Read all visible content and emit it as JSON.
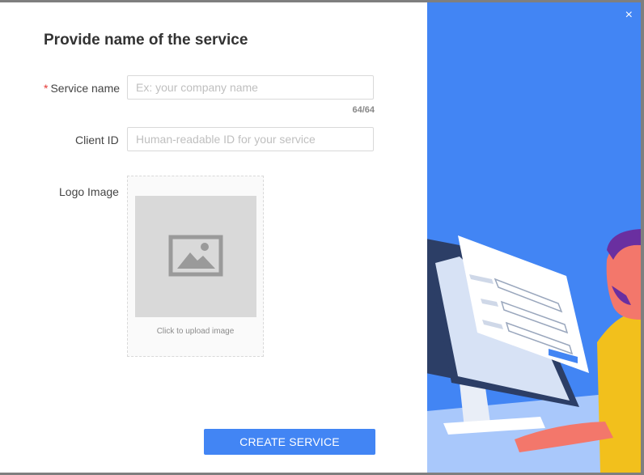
{
  "dialog": {
    "title": "Provide name of the service",
    "close_label": "×"
  },
  "form": {
    "service_name": {
      "required_mark": "*",
      "label": "Service name",
      "placeholder": "Ex: your company name",
      "value": "",
      "counter": "64/64"
    },
    "client_id": {
      "label": "Client ID",
      "placeholder": "Human-readable ID for your service",
      "value": ""
    },
    "logo": {
      "label": "Logo Image",
      "upload_text": "Click to upload image",
      "icon": "image-placeholder-icon"
    }
  },
  "actions": {
    "create_label": "CREATE SERVICE"
  },
  "colors": {
    "accent": "#4285f4",
    "required": "#e53935",
    "illustration_bg": "#4285f4"
  }
}
